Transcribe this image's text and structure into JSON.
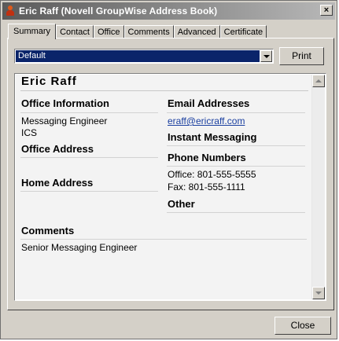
{
  "window": {
    "title": "Eric Raff (Novell GroupWise Address Book)",
    "close_glyph": "×"
  },
  "tabs": [
    {
      "label": "Summary",
      "active": true
    },
    {
      "label": "Contact",
      "active": false
    },
    {
      "label": "Office",
      "active": false
    },
    {
      "label": "Comments",
      "active": false
    },
    {
      "label": "Advanced",
      "active": false
    },
    {
      "label": "Certificate",
      "active": false
    }
  ],
  "view_select": {
    "value": "Default"
  },
  "print_button": "Print",
  "close_button": "Close",
  "card": {
    "name": "Eric Raff",
    "office_information": {
      "heading": "Office Information",
      "title": "Messaging Engineer",
      "department": "ICS"
    },
    "office_address": {
      "heading": "Office Address"
    },
    "home_address": {
      "heading": "Home Address"
    },
    "comments": {
      "heading": "Comments",
      "text": "Senior Messaging Engineer"
    },
    "email": {
      "heading": "Email Addresses",
      "address": "eraff@ericraff.com"
    },
    "instant_messaging": {
      "heading": "Instant Messaging"
    },
    "phone_numbers": {
      "heading": "Phone Numbers",
      "office": "Office: 801-555-5555",
      "fax": "Fax: 801-555-1111"
    },
    "other": {
      "heading": "Other"
    }
  },
  "colors": {
    "selection": "#0a246a",
    "link": "#1a3fa0",
    "face": "#d4d0c8"
  }
}
